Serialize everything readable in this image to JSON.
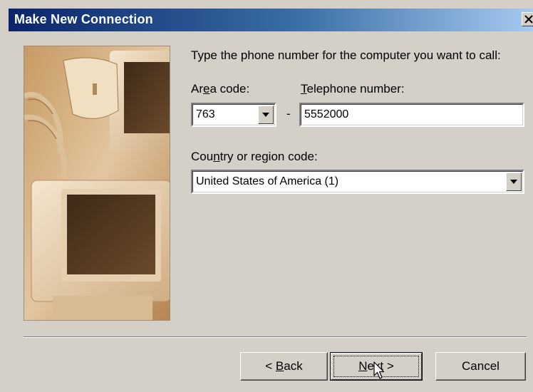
{
  "window": {
    "title": "Make New Connection",
    "close_glyph": "✕"
  },
  "icons": [
    "close-icon",
    "dropdown-arrow-icon",
    "mouse-pointer-icon"
  ],
  "illustration": "computer-monitors-and-phone-cord-sepia",
  "instruction": "Type the phone number for the computer you want to call:",
  "area_code": {
    "label_prefix": "Ar",
    "label_mnemonic": "e",
    "label_suffix": "a code:",
    "value": "763"
  },
  "dash": "-",
  "telephone": {
    "label_mnemonic": "T",
    "label_suffix": "elephone number:",
    "value": "5552000"
  },
  "country": {
    "label_prefix": "Cou",
    "label_mnemonic": "n",
    "label_suffix": "try or region code:",
    "value": "United States of America (1)"
  },
  "buttons": {
    "back": {
      "prefix": "< ",
      "mnemonic": "B",
      "suffix": "ack"
    },
    "next": {
      "prefix": "",
      "mnemonic": "N",
      "suffix": "ext >"
    },
    "cancel": {
      "label": "Cancel"
    }
  },
  "colors": {
    "title_bar_start": "#0a246a",
    "title_bar_end": "#a6caf0",
    "dialog_face": "#d4d0c8",
    "illustration_tone": "#b88a55"
  }
}
